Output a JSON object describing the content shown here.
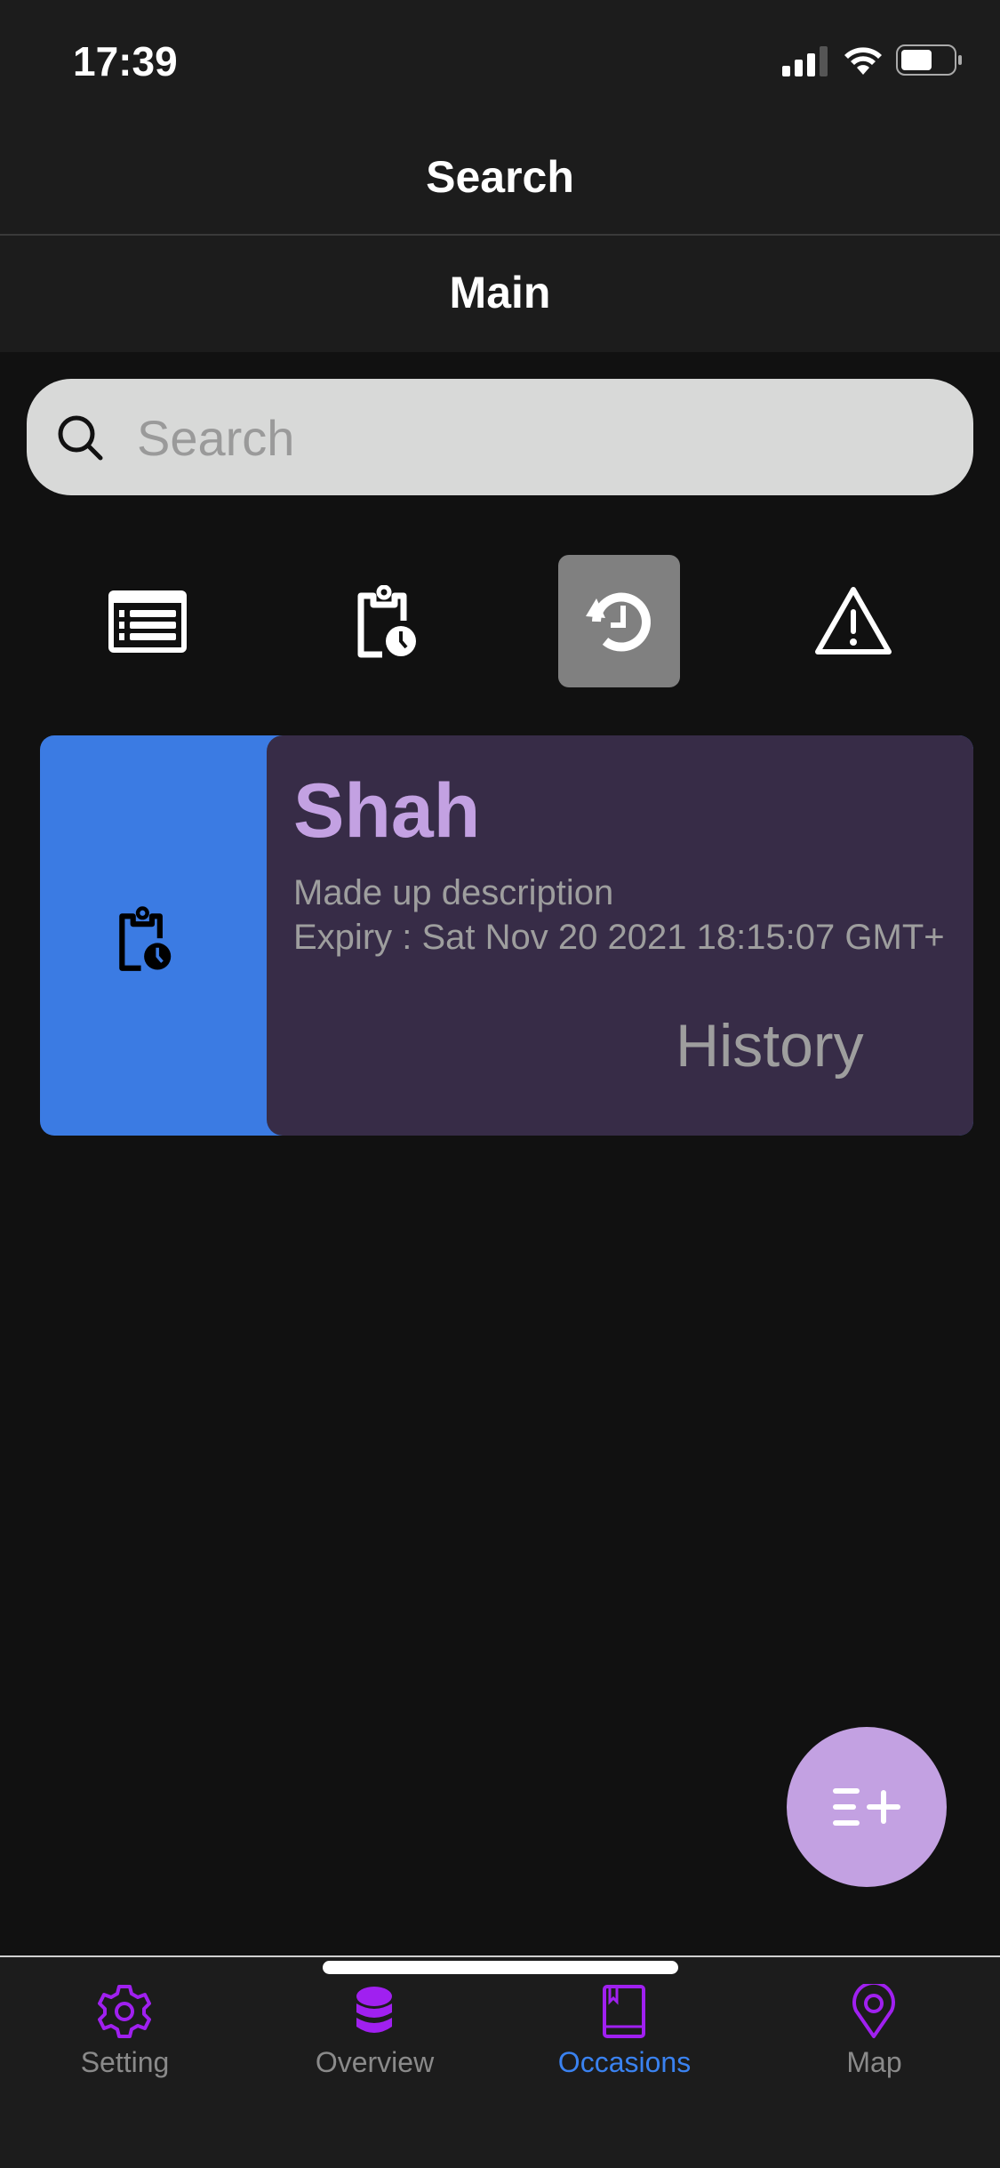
{
  "status_bar": {
    "time": "17:39",
    "icons": [
      "signal-icon",
      "wifi-icon",
      "battery-icon"
    ]
  },
  "header": {
    "title": "Search",
    "subtitle": "Main"
  },
  "search": {
    "placeholder": "Search",
    "value": "",
    "icon": "search-icon"
  },
  "filters": [
    {
      "icon": "list-icon",
      "selected": false
    },
    {
      "icon": "clipboard-clock-icon",
      "selected": false
    },
    {
      "icon": "history-icon",
      "selected": true
    },
    {
      "icon": "warning-icon",
      "selected": false
    }
  ],
  "cards": [
    {
      "name": "Shah",
      "description": "Made up description",
      "expiry": "Expiry : Sat Nov 20 2021 18:15:07 GMT+",
      "status": "History",
      "swipe_action_icon": "clipboard-clock-icon"
    }
  ],
  "fab": {
    "icon": "add-list-icon"
  },
  "tabbar": {
    "items": [
      {
        "label": "Setting",
        "icon": "gear-icon"
      },
      {
        "label": "Overview",
        "icon": "database-icon"
      },
      {
        "label": "Occasions",
        "icon": "book-icon",
        "active": true
      },
      {
        "label": "Map",
        "icon": "map-pin-icon"
      }
    ]
  },
  "colors": {
    "accent": "#c3a1e2",
    "tab_icon": "#a020f0",
    "active_tab": "#3a82f0",
    "swipe_action": "#3b7be3",
    "card_bg": "#372c47"
  }
}
